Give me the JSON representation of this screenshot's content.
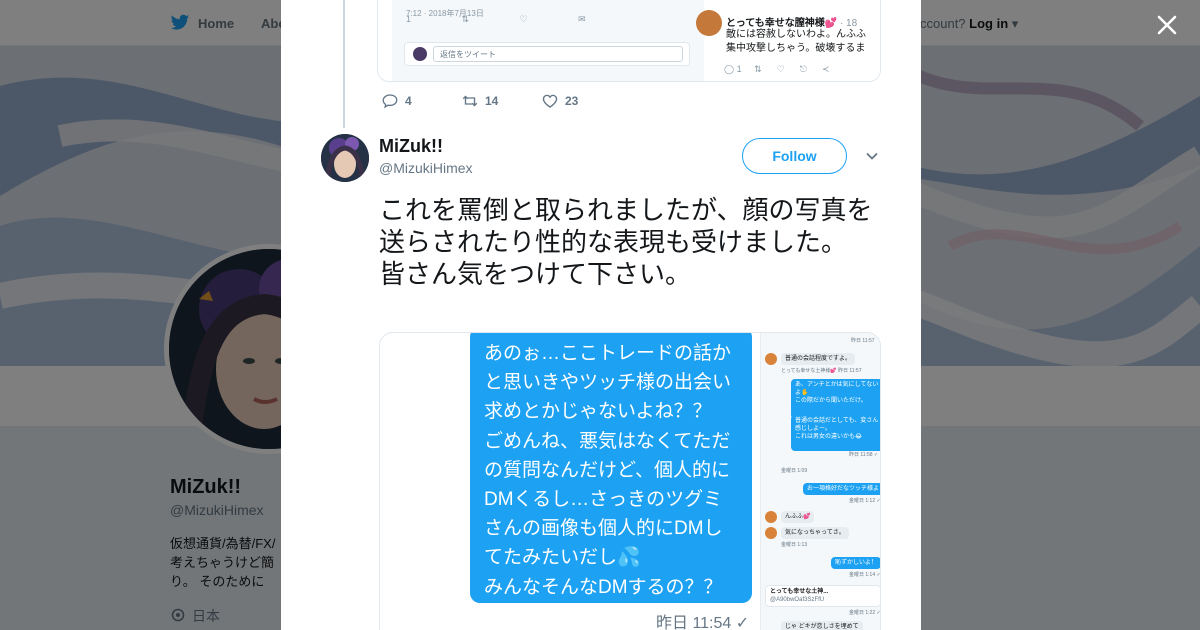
{
  "topnav": {
    "home_label": "Home",
    "about_label": "Abo",
    "account_prompt": "ccount?",
    "login_label": "Log in"
  },
  "background_profile": {
    "name": "MiZuk!!",
    "handle": "@MizukiHimex",
    "bio_line1": "仮想通貨/為替/FX/",
    "bio_line2": "考えちゃうけど簡",
    "bio_line3": "り。 そのために",
    "location": "日本"
  },
  "quoted_media": {
    "left_meta": "7:12 · 2018年7月13日",
    "left_icons": [
      "1",
      "",
      "",
      ""
    ],
    "reply_placeholder": "返信をツイート",
    "right_name": "とっても幸せな膣神様💕",
    "right_time": "· 18",
    "right_line1": "敵には容赦しないわよ。んふふ",
    "right_line2": "集中攻撃しちゃう。破壊するま",
    "right_actions": [
      "1",
      "",
      "",
      ""
    ]
  },
  "previous_tweet": {
    "replies": "4",
    "retweets": "14",
    "likes": "23"
  },
  "tweet": {
    "name": "MiZuk!!",
    "handle": "@MizukiHimex",
    "follow_label": "Follow",
    "text": "これを罵倒と取られましたが、顔の写真を送らされたり性的な表現も受けました。\n皆さん気をつけて下さい。"
  },
  "media": {
    "bubble_text": "あのぉ…ここトレードの話かと思いきやツッチ様の出会い求めとかじゃないよね？？\nごめんね、悪気はなくてただの質問なんだけど、個人的にDMくるし…さっきのツグミさんの画像も個人的にDMしてたみたいだし💦\nみんなそんなDMするの？？",
    "timestamp": "昨日 11:54 ✓",
    "side_chat": {
      "r1": "昨日 11:57",
      "r2": "普通の会話程度ですよ。",
      "r3": "とっても幸せな土神様💕  昨日 11:57",
      "r4a": "あ、アンチとかは気にしてない",
      "r4b": "よ✋",
      "r4c": "この際だから聞いただけ。",
      "r5a": "普通の会話だとしても、変さん",
      "r5b": "感じしよー。",
      "r5c": "これは男女の違いかも😂",
      "r6": "昨日 11:58 ✓",
      "r7": "金曜日 1:09",
      "r8": "お一項格好だなツッチ様よ",
      "r9": "金曜日 1:12 ✓",
      "r10": "んふふ💕",
      "r11": "気になっちゃってさ。",
      "r12": "金曜日 1:13",
      "r13": "恥ずかしいよ！",
      "r14": "金曜日 1:14 ✓",
      "r15": "とっても幸せな土神...",
      "r16": "@A90bwOaf3SzFfU",
      "r17": "金曜日 1:22 ✓",
      "r18": "じゃ どキが恋しさを埋めて"
    }
  },
  "colors": {
    "accent": "#1da1f2",
    "text": "#14171a",
    "muted": "#657786"
  }
}
